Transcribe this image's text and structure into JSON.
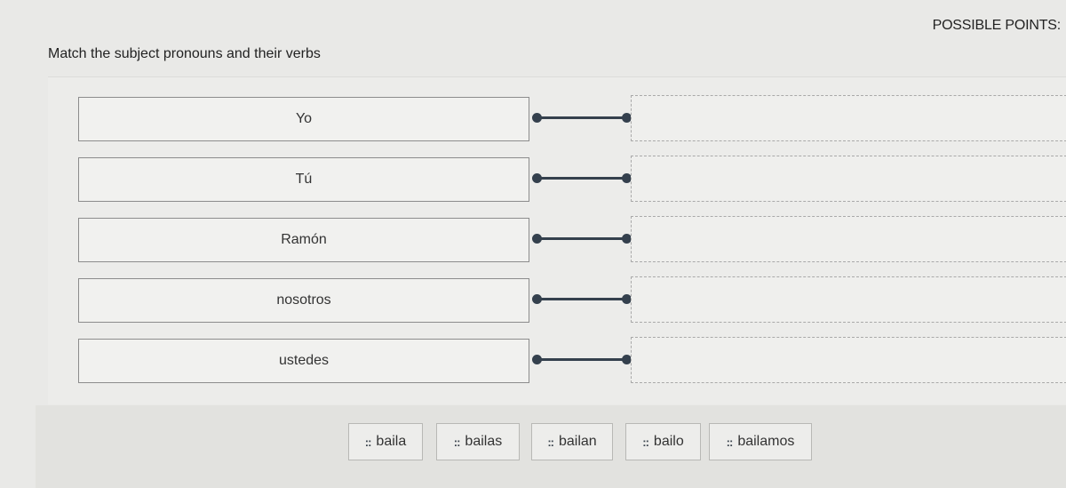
{
  "header": {
    "points_label": "POSSIBLE POINTS:"
  },
  "question": {
    "text": "Match the subject pronouns and their verbs"
  },
  "prompts": [
    {
      "label": "Yo"
    },
    {
      "label": "Tú"
    },
    {
      "label": "Ramón"
    },
    {
      "label": "nosotros"
    },
    {
      "label": "ustedes"
    }
  ],
  "answer_bank": [
    {
      "label": "baila"
    },
    {
      "label": "bailas"
    },
    {
      "label": "bailan"
    },
    {
      "label": "bailo"
    },
    {
      "label": "bailamos"
    }
  ],
  "icons": {
    "grip": "drag-grip-icon",
    "grip_glyph": "::"
  },
  "colors": {
    "connector": "#34404d",
    "background": "#e9e9e7"
  }
}
